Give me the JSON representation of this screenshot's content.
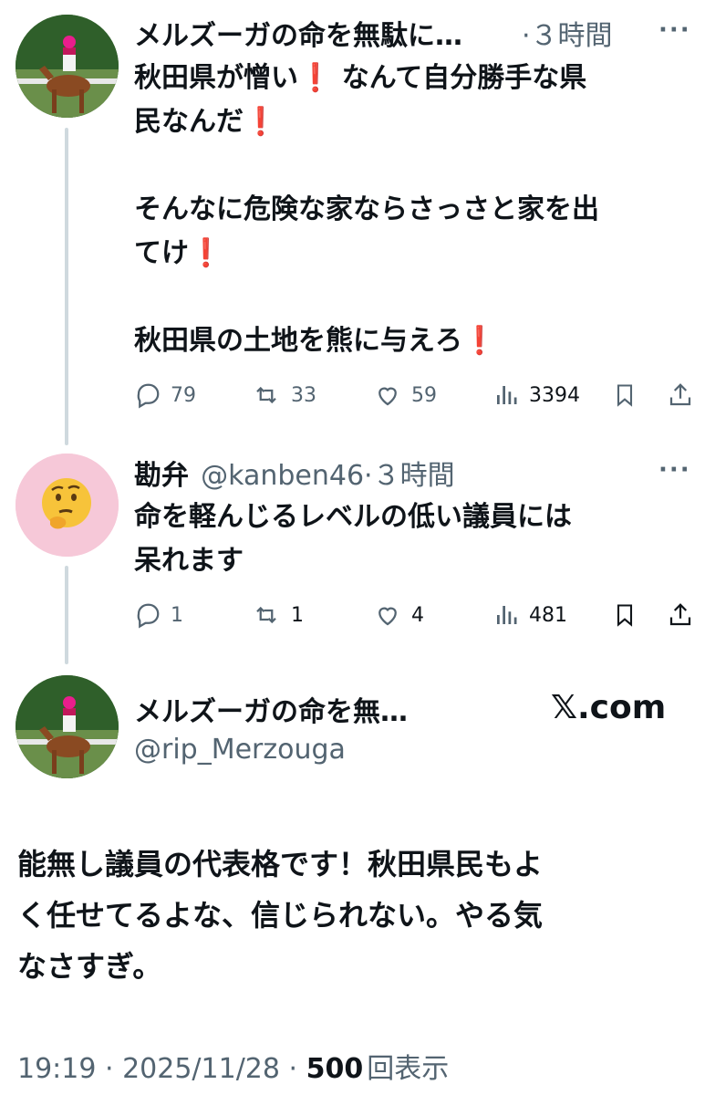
{
  "tweet1": {
    "author": "メルズーガの命を無駄に…",
    "dot_time": "·３時間",
    "more": "···",
    "lines": [
      "秋田県が憎い❗️ なんて自分勝手な県",
      "民なんだ❗️",
      "そんなに危険な家ならさっさと家を出",
      "てけ❗️",
      "秋田県の土地を熊に与えろ❗️"
    ],
    "replies": "79",
    "retweets": "33",
    "likes": "59",
    "views": "3394"
  },
  "tweet2": {
    "author": "勘弁",
    "handle": "@kanben46",
    "dot_time": "·３時間",
    "more": "···",
    "lines": [
      "命を軽んじるレベルの低い議員には",
      "呆れます"
    ],
    "replies": "1",
    "retweets": "1",
    "likes": "4",
    "views": "481"
  },
  "tweet3": {
    "author": "メルズーガの命を無…",
    "handle": "@rip_Merzouga",
    "site": "𝕏.com",
    "lines": [
      "能無し議員の代表格です！秋田県民もよ",
      "く任せてるよな、信じられない。やる気",
      "なさすぎ。"
    ],
    "timestamp": "19:19 · 2025/11/28 · ",
    "views_count": "500",
    "views_label": "回表示"
  },
  "colors": {
    "text": "#0f1419",
    "secondary": "#536471",
    "thread": "#cfd9de",
    "avatar_pink": "#f6c8d8"
  },
  "icons": [
    "reply-icon",
    "retweet-icon",
    "like-icon",
    "views-icon",
    "bookmark-icon",
    "share-icon"
  ]
}
